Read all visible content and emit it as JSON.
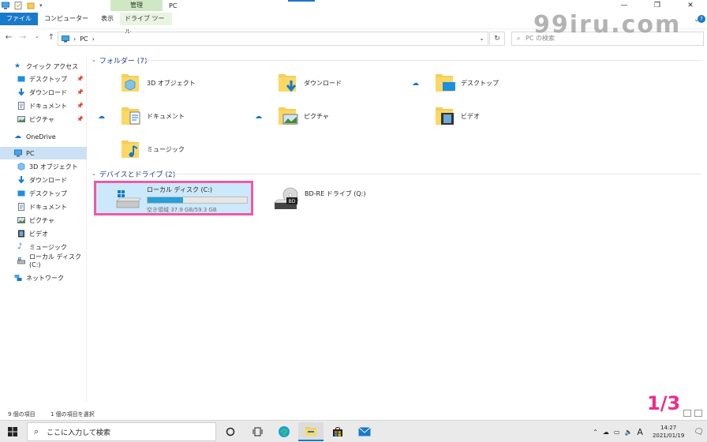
{
  "window": {
    "title": "PC",
    "context_group": "管理",
    "tabs": [
      "ファイル",
      "コンピューター",
      "表示",
      "ドライブ ツール"
    ],
    "controls": [
      "—",
      "❐",
      "✕"
    ]
  },
  "address": {
    "path": [
      "PC"
    ],
    "search_placeholder": "PC の検索"
  },
  "watermark": "99iru.com",
  "sidebar": {
    "quick_access": "クイック アクセス",
    "quick_items": [
      {
        "label": "デスクトップ",
        "icon": "desktop-icon"
      },
      {
        "label": "ダウンロード",
        "icon": "download-icon"
      },
      {
        "label": "ドキュメント",
        "icon": "document-icon"
      },
      {
        "label": "ピクチャ",
        "icon": "picture-icon"
      }
    ],
    "onedrive": "OneDrive",
    "pc": "PC",
    "pc_items": [
      {
        "label": "3D オブジェクト",
        "icon": "3d-objects-icon"
      },
      {
        "label": "ダウンロード",
        "icon": "download-icon"
      },
      {
        "label": "デスクトップ",
        "icon": "desktop-icon"
      },
      {
        "label": "ドキュメント",
        "icon": "document-icon"
      },
      {
        "label": "ピクチャ",
        "icon": "picture-icon"
      },
      {
        "label": "ビデオ",
        "icon": "video-icon"
      },
      {
        "label": "ミュージック",
        "icon": "music-icon"
      },
      {
        "label": "ローカル ディスク (C:)",
        "icon": "drive-icon"
      }
    ],
    "network": "ネットワーク"
  },
  "main": {
    "folders_header": "フォルダー (7)",
    "folders": [
      {
        "label": "3D オブジェクト",
        "cloud": false
      },
      {
        "label": "ダウンロード",
        "cloud": false
      },
      {
        "label": "デスクトップ",
        "cloud": true
      },
      {
        "label": "ドキュメント",
        "cloud": true
      },
      {
        "label": "ピクチャ",
        "cloud": true
      },
      {
        "label": "ビデオ",
        "cloud": false
      },
      {
        "label": "ミュージック",
        "cloud": false
      }
    ],
    "devices_header": "デバイスとドライブ (2)",
    "drive_c": {
      "label": "ローカル ディスク (C:)",
      "free_text": "空き領域 37.9 GB/59.3 GB",
      "used_fraction": 0.36
    },
    "drive_q": {
      "label": "BD-RE ドライブ (Q:)",
      "badge": "BD"
    }
  },
  "status": {
    "count": "9 個の項目",
    "selected": "1 個の項目を選択"
  },
  "page_indicator": "1/3",
  "taskbar": {
    "search_placeholder": "ここに入力して検索",
    "ime": "A",
    "time": "14:27",
    "date": "2021/01/19"
  },
  "colors": {
    "accent": "#1979ca",
    "selection_outline": "#ee5aa5",
    "page_indicator": "#ee2b8e",
    "progress": "#26a0da",
    "folder": "#f7cd58"
  }
}
